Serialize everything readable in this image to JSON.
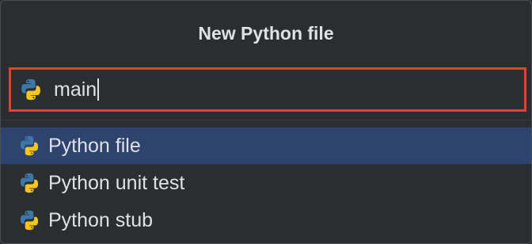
{
  "dialog": {
    "title": "New Python file"
  },
  "name_field": {
    "value": "main",
    "icon": "python-icon"
  },
  "templates": [
    {
      "label": "Python file",
      "icon": "python-icon",
      "selected": true
    },
    {
      "label": "Python unit test",
      "icon": "python-icon",
      "selected": false
    },
    {
      "label": "Python stub",
      "icon": "python-icon",
      "selected": false
    }
  ],
  "colors": {
    "background": "#2b2d30",
    "focus_border": "#e0442a",
    "selection": "#2e436e",
    "text": "#dfe1e5",
    "python_blue": "#3b77a8",
    "python_yellow": "#f5c518"
  }
}
